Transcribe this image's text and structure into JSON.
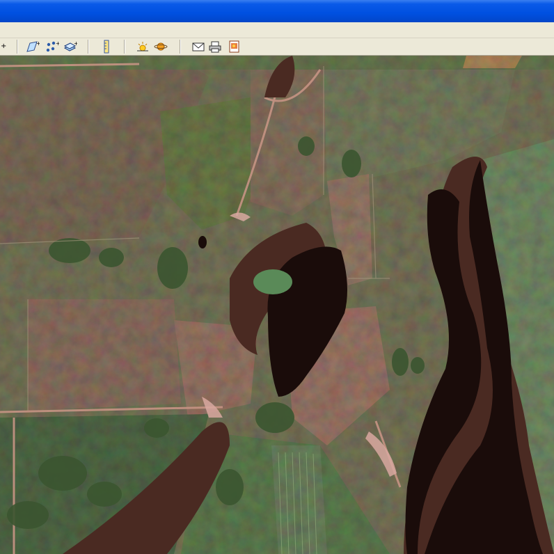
{
  "window": {
    "title": ""
  },
  "toolbar": {
    "buttons": [
      {
        "icon": "add-vertex-icon"
      },
      {
        "icon": "polygon-add-icon"
      },
      {
        "icon": "points-add-icon"
      },
      {
        "icon": "layer-add-icon"
      },
      {
        "icon": "ruler-icon"
      },
      {
        "icon": "sun-icon"
      },
      {
        "icon": "planet-icon"
      },
      {
        "icon": "email-icon"
      },
      {
        "icon": "print-icon"
      },
      {
        "icon": "save-image-icon"
      }
    ]
  },
  "map": {
    "type": "satellite-imagery",
    "colors": {
      "water": "#1a0c0a",
      "field": "#8a8a68",
      "vegetation": "#3c5a30",
      "road": "#c89080"
    }
  }
}
